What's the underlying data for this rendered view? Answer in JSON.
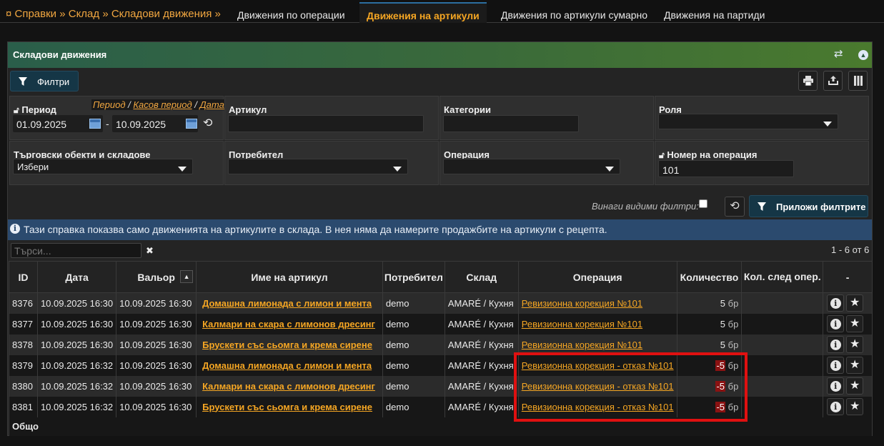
{
  "topnav": {
    "breadcrumb": "¤ Справки » Склад » Складови движения »",
    "tabs": [
      {
        "label": "Движения по операции"
      },
      {
        "label": "Движения на артикули"
      },
      {
        "label": "Движения по артикули сумарно"
      },
      {
        "label": "Движения на партиди"
      }
    ],
    "active_tab": "Движения на артикули"
  },
  "panel": {
    "title": "Складови движения",
    "filters_button": "Филтри",
    "icons": [
      "swap-icon",
      "collapse-icon",
      "print-icon",
      "export-icon",
      "columns-icon"
    ]
  },
  "filters": {
    "period": {
      "label": "Период",
      "link1": "Период",
      "link2": "Касов период",
      "link3": "Дата",
      "from": "01.09.2025",
      "to": "10.09.2025",
      "separator": "-"
    },
    "article": {
      "label": "Артикул",
      "value": ""
    },
    "categories": {
      "label": "Категории",
      "value": ""
    },
    "role": {
      "label": "Роля",
      "value": ""
    },
    "stores": {
      "label": "Търговски обекти и складове",
      "value": "Избери"
    },
    "user": {
      "label": "Потребител",
      "value": ""
    },
    "operation": {
      "label": "Операция",
      "value": ""
    },
    "op_number": {
      "label": "Номер на операция",
      "value": "101"
    },
    "always_visible": "Винаги видими филтри:",
    "apply_button": "Приложи филтрите"
  },
  "info": {
    "text": "Тази справка показва само движенията на артикулите в склада. В нея няма да намерите продажбите на артикули с рецепта."
  },
  "search": {
    "placeholder": "Търси...",
    "clear": "✖"
  },
  "pagination": "1 - 6 от 6",
  "table": {
    "headers": [
      "ID",
      "Дата",
      "Вальор",
      "Име на артикул",
      "Потребител",
      "Склад",
      "Операция",
      "Количество",
      "Кол. след опер.",
      "-"
    ],
    "rows": [
      {
        "id": "8376",
        "date": "10.09.2025 16:30",
        "valor": "10.09.2025 16:30",
        "article": "Домашна лимонада с лимон и мента",
        "user": "demo",
        "warehouse": "AMARÉ / Кухня",
        "operation": "Ревизионна корекция №101",
        "qty": "5",
        "unit": "бр",
        "negative": false
      },
      {
        "id": "8377",
        "date": "10.09.2025 16:30",
        "valor": "10.09.2025 16:30",
        "article": "Калмари на скара с лимонов дресинг",
        "user": "demo",
        "warehouse": "AMARÉ / Кухня",
        "operation": "Ревизионна корекция №101",
        "qty": "5",
        "unit": "бр",
        "negative": false
      },
      {
        "id": "8378",
        "date": "10.09.2025 16:30",
        "valor": "10.09.2025 16:30",
        "article": "Брускети със сьомга и крема сирене",
        "user": "demo",
        "warehouse": "AMARÉ / Кухня",
        "operation": "Ревизионна корекция №101",
        "qty": "5",
        "unit": "бр",
        "negative": false
      },
      {
        "id": "8379",
        "date": "10.09.2025 16:32",
        "valor": "10.09.2025 16:30",
        "article": "Домашна лимонада с лимон и мента",
        "user": "demo",
        "warehouse": "AMARÉ / Кухня",
        "operation": "Ревизионна корекция - отказ №101",
        "qty": "-5",
        "unit": "бр",
        "negative": true
      },
      {
        "id": "8380",
        "date": "10.09.2025 16:32",
        "valor": "10.09.2025 16:30",
        "article": "Калмари на скара с лимонов дресинг",
        "user": "demo",
        "warehouse": "AMARÉ / Кухня",
        "operation": "Ревизионна корекция - отказ №101",
        "qty": "-5",
        "unit": "бр",
        "negative": true
      },
      {
        "id": "8381",
        "date": "10.09.2025 16:32",
        "valor": "10.09.2025 16:30",
        "article": "Брускети със сьомга и крема сирене",
        "user": "demo",
        "warehouse": "AMARÉ / Кухня",
        "operation": "Ревизионна корекция - отказ №101",
        "qty": "-5",
        "unit": "бр",
        "negative": true
      }
    ],
    "footer": "Общо"
  },
  "colors": {
    "accent": "#f5a623",
    "header_gradient_start": "#2a5e4a",
    "info_bar": "#2b4a6e",
    "highlight": "#e01010"
  }
}
